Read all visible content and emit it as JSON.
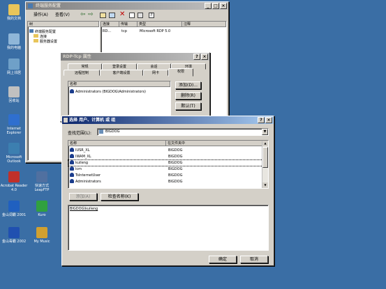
{
  "desktop": {
    "icons": [
      {
        "label": "我的文档",
        "icon": "folder-icon",
        "color": "#e8c55a"
      },
      {
        "label": "我的电脑",
        "icon": "computer-icon",
        "color": "#8fb6d8"
      },
      {
        "label": "网上邻居",
        "icon": "network-icon",
        "color": "#6fa0c8"
      },
      {
        "label": "回收站",
        "icon": "recycle-bin-icon",
        "color": "#c0c0c0"
      },
      {
        "label": "Internet Explorer",
        "icon": "ie-icon",
        "color": "#2f6fcf"
      },
      {
        "label": "Microsoft Outlook",
        "icon": "outlook-icon",
        "color": "#3c7fb0"
      },
      {
        "label": "Acrobat Reader 4.0",
        "icon": "acrobat-icon",
        "color": "#c0302a"
      },
      {
        "label": "快速方式 LeapFTP",
        "icon": "leapftp-icon",
        "color": "#5070a0"
      },
      {
        "label": "金山词霸 2001",
        "icon": "kingsoft-icon",
        "color": "#2060c0"
      },
      {
        "label": "Kuro",
        "icon": "kuro-icon",
        "color": "#30a040"
      },
      {
        "label": "金山毒霸 2002",
        "icon": "antivirus-icon",
        "color": "#2050b0"
      },
      {
        "label": "My Music",
        "icon": "music-icon",
        "color": "#d0a030"
      }
    ]
  },
  "term_window": {
    "title": "终端服务配置",
    "menu": [
      "操作(A)",
      "查看(V)"
    ],
    "tree_header": "树",
    "tree": [
      "终端服务配置",
      "连接",
      "服务器设置"
    ],
    "list_headers": [
      "连接",
      "传输",
      "类型",
      "注释"
    ],
    "list_row": [
      "RD...",
      "tcp",
      "Microsoft RDP 5.0",
      ""
    ]
  },
  "props_dialog": {
    "title": "RDP-Tcp 属性",
    "tabs_row1": [
      "常规",
      "登录设置",
      "会话",
      "环境"
    ],
    "tabs_row2": [
      "远程控制",
      "客户端设置",
      "网卡",
      "权限"
    ],
    "list_header": "名称",
    "list_item": "Administrators (BIGDOG\\Administrators)",
    "buttons": [
      "添加(D)...",
      "删除(R)",
      "默认(T)"
    ]
  },
  "select_dialog": {
    "title": "选择 用户、计算机 或 组",
    "lookin_label": "查找范围(L):",
    "lookin_value": "BIGDOG",
    "col_name": "名称",
    "col_folder": "在文件夹中",
    "rows": [
      {
        "name": "IUSR_XL",
        "folder": "BIGDOG"
      },
      {
        "name": "IWAM_XL",
        "folder": "BIGDOG"
      },
      {
        "name": "kuileng",
        "folder": "BIGDOG"
      },
      {
        "name": "lcm",
        "folder": "BIGDOG"
      },
      {
        "name": "TsInternetUser",
        "folder": "BIGDOG"
      },
      {
        "name": "Administrators",
        "folder": "BIGDOG"
      }
    ],
    "add_button": "添加(A)",
    "check_button": "检查名称(K)",
    "entered_value": "BIGDOG\\kuileng",
    "ok_button": "确定",
    "cancel_button": "取消"
  }
}
